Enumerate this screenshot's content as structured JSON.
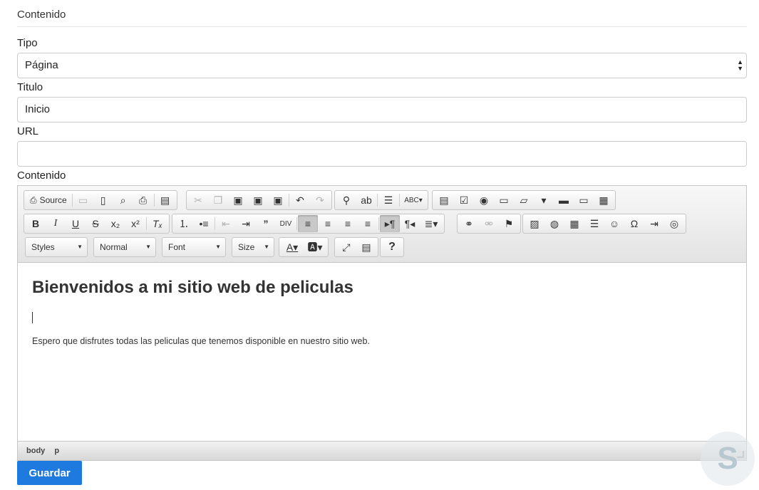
{
  "section": {
    "title": "Contenido"
  },
  "form": {
    "tipo": {
      "label": "Tipo",
      "value": "Página"
    },
    "titulo": {
      "label": "Titulo",
      "value": "Inicio"
    },
    "url": {
      "label": "URL",
      "value": ""
    },
    "contenido": {
      "label": "Contenido"
    }
  },
  "editor": {
    "toolbar": {
      "source_label": "Source",
      "combos": {
        "styles": "Styles",
        "format": "Normal",
        "font": "Font",
        "size": "Size"
      }
    },
    "content": {
      "heading": "Bienvenidos a mi sitio web de peliculas",
      "paragraph": "Espero que disfrutes todas las peliculas que tenemos disponible en nuestro sitio web."
    },
    "statusbar": {
      "path": [
        "body",
        "p"
      ]
    }
  },
  "actions": {
    "save_label": "Guardar"
  },
  "colors": {
    "primary": "#1f7ae0"
  }
}
